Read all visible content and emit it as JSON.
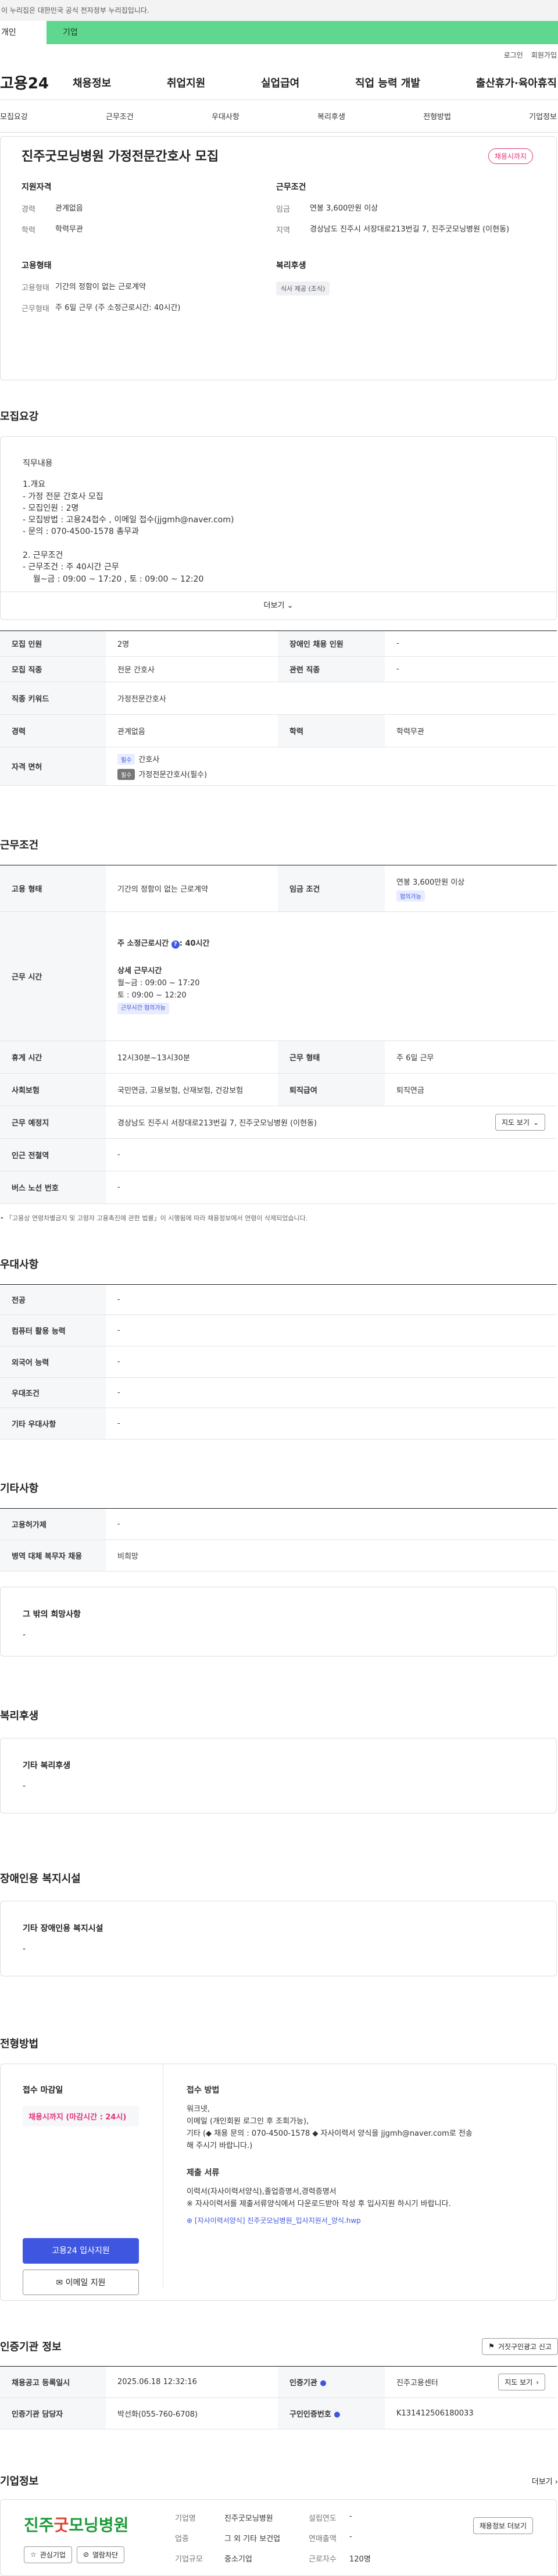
{
  "gov": {
    "notice": "이 누리집은 대한민국 공식 전자정부 누리집입니다."
  },
  "tabs": {
    "a": "개인",
    "b": "기업"
  },
  "util": {
    "login": "로그인",
    "join": "회원가입"
  },
  "gnb": {
    "logo": "고용24",
    "menu": [
      "채용정보",
      "취업지원",
      "실업급여",
      "직업 능력 개발",
      "출산휴가·육아휴직"
    ]
  },
  "subnav": [
    "모집요강",
    "근무조건",
    "우대사항",
    "복리후생",
    "전형방법",
    "기업정보"
  ],
  "summary": {
    "title": "진주굿모닝병원 가정전문간호사 모집",
    "badge": "채용시까지",
    "qual_label": "지원자격",
    "career_k": "경력",
    "career_v": "관계없음",
    "edu_k": "학력",
    "edu_v": "학력무관",
    "cond_label": "근무조건",
    "wage_k": "임금",
    "wage_v": "연봉 3,600만원 이상",
    "region_k": "지역",
    "region_v": "경상남도 진주시 서장대로213번길 7, 진주굿모닝병원 (이현동)",
    "emp_label": "고용형태",
    "emptype_k": "고용형태",
    "emptype_v": "기간의 정함이 없는 근로계약",
    "worktype_k": "근무형태",
    "worktype_v": "주 6일 근무 (주 소정근로시간: 40시간)",
    "welfare_label": "복리후생",
    "welfare_chip": "식사 제공 (조식)"
  },
  "recruit": {
    "title": "모집요강",
    "desc_title": "직무내용",
    "desc_lines": [
      "1.개요",
      "- 가정 전문 간호사 모집",
      "- 모집인원 : 2명",
      "- 모집방법 : 고용24접수 , 이메일 접수(jjgmh@naver.com)",
      "- 문의 : 070-4500-1578 총무과",
      "",
      "2. 근무조건",
      "- 근무조건 : 주 40시간 근무",
      "    월~금 : 09:00 ~ 17:20 , 토 : 09:00 ~ 12:20"
    ],
    "more": "더보기",
    "headcount_k": "모집 인원",
    "headcount_v": "2명",
    "disabled_k": "장애인 채용 인원",
    "disabled_v": "-",
    "job_k": "모집 직종",
    "job_v": "전문 간호사",
    "related_k": "관련 직종",
    "related_v": "-",
    "keyword_k": "직종 키워드",
    "keyword_v": "가정전문간호사",
    "career_k": "경력",
    "career_v": "관계없음",
    "edu_k": "학력",
    "edu_v": "학력무관",
    "license_k": "자격 면허",
    "license_tag1": "필수",
    "license_v1": "간호사",
    "license_tag2": "필수",
    "license_v2": "가정전문간호사(필수)"
  },
  "work": {
    "title": "근무조건",
    "emptype_k": "고용 형태",
    "emptype_v": "기간의 정함이 없는 근로계약",
    "wage_k": "임금 조건",
    "wage_v": "연봉 3,600만원 이상",
    "wage_tag": "협의가능",
    "hours_k": "근무 시간",
    "hours_main": "주 소정근로시간",
    "hours_val": ": 40시간",
    "hours_detail_title": "상세 근무시간",
    "hours_l1": "월~금 : 09:00 ~ 17:20",
    "hours_l2": "토 : 09:00 ~ 12:20",
    "hours_tag": "근무시간 협의가능",
    "break_k": "휴게 시간",
    "break_v": "12시30분~13시30분",
    "wform_k": "근무 형태",
    "wform_v": "주 6일 근무",
    "ins_k": "사회보험",
    "ins_v": "국민연금, 고용보험, 산재보험, 건강보험",
    "retire_k": "퇴직급여",
    "retire_v": "퇴직연금",
    "place_k": "근무 예정지",
    "place_v": "경상남도 진주시 서장대로213번길 7, 진주굿모닝병원 (이현동)",
    "map_btn": "지도 보기",
    "subway_k": "인근 전철역",
    "subway_v": "-",
    "bus_k": "버스 노선 번호",
    "bus_v": "-",
    "note": "「고용상 연령차별금지 및 고령자 고용촉진에 관한 법률」이 시행됨에 따라 채용정보에서 연령이 삭제되었습니다."
  },
  "pref": {
    "title": "우대사항",
    "major_k": "전공",
    "major_v": "-",
    "pc_k": "컴퓨터 활용 능력",
    "pc_v": "-",
    "lang_k": "외국어 능력",
    "lang_v": "-",
    "cond_k": "우대조건",
    "cond_v": "-",
    "etc_k": "기타 우대사항",
    "etc_v": "-"
  },
  "other": {
    "title": "기타사항",
    "insurance_k": "고용허가제",
    "insurance_v": "-",
    "military_k": "병역 대체 복무자 채용",
    "military_v": "비희망",
    "box_title": "그 밖의 희망사항",
    "box_v": "-"
  },
  "welfare": {
    "title": "복리후생",
    "box_title": "기타 복리후생",
    "box_v": "-"
  },
  "facility": {
    "title": "장애인용 복지시설",
    "box_title": "기타 장애인용 복지시설",
    "box_v": "-"
  },
  "apply": {
    "title": "전형방법",
    "deadline_label": "접수 마감일",
    "deadline_v": "채용시까지 (마감시간 : 24시)",
    "apply_btn": "고용24 입사지원",
    "email_btn": "이메일 지원",
    "method_title": "접수 방법",
    "method_lines": [
      "워크넷,",
      "이메일 (개인회원 로그인 후 조회가능),",
      "기타 (◆ 채용 문의 : 070-4500-1578 ◆ 자사이력서 양식을 jjgmh@naver.com로 전송",
      "해 주시기 바랍니다.)"
    ],
    "docs_title": "제출 서류",
    "docs_lines": [
      "이력서(자사이력서양식),졸업증명서,경력증명서",
      "※ 자사이력서를 제출서류양식에서 다운로드받아 작성 후 입사지원 하시기 바랍니다."
    ],
    "file": "[자사이력서양식] 진주굿모닝병원_입사지원서_양식.hwp"
  },
  "agency": {
    "title": "인증기관 정보",
    "report_btn": "거짓구인광고 신고",
    "reg_k": "채용공고 등록일시",
    "reg_v": "2025.06.18 12:32:16",
    "org_k": "인증기관",
    "org_v": "진주고용센터",
    "map_btn": "지도 보기",
    "manager_k": "인증기관 담당자",
    "manager_v": "박선화(055-760-6708)",
    "reqno_k": "구인인증번호",
    "reqno_v": "K131412506180033"
  },
  "company": {
    "title": "기업정보",
    "more": "더보기",
    "logo_a": "진주",
    "logo_b": "굿",
    "logo_c": "모닝병원",
    "interest_btn": "관심기업",
    "block_btn": "열람차단",
    "name_k": "기업명",
    "name_v": "진주굿모닝병원",
    "year_k": "설립연도",
    "year_v": "-",
    "ind_k": "업종",
    "ind_v": "그 외 기타 보건업",
    "sales_k": "연매출액",
    "sales_v": "-",
    "size_k": "기업규모",
    "size_v": "중소기업",
    "emp_k": "근로자수",
    "emp_v": "120명",
    "jobs_btn": "채용정보 더보기"
  }
}
